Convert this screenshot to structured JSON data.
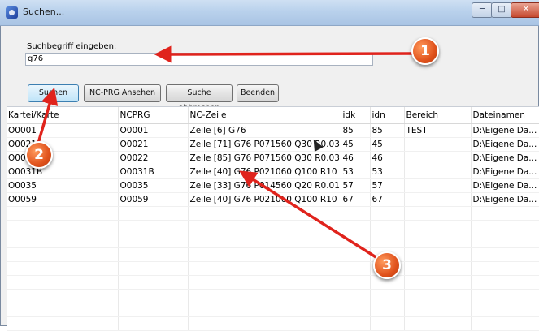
{
  "window": {
    "title": "Suchen...",
    "min_icon": "minimize-icon",
    "max_icon": "maximize-icon",
    "close_icon": "close-icon"
  },
  "search": {
    "label": "Suchbegriff eingeben:",
    "value": "g76"
  },
  "buttons": {
    "search": "Suchen",
    "view": "NC-PRG Ansehen",
    "cancel": "Suche abbrechen",
    "exit": "Beenden"
  },
  "table": {
    "columns": [
      "Kartei/Karte",
      "NCPRG",
      "NC-Zeile",
      "idk",
      "idn",
      "Bereich",
      "Dateinamen"
    ],
    "rows": [
      [
        "O0001",
        "O0001",
        "Zeile [6] G76",
        "85",
        "85",
        "TEST",
        "D:\\Eigene Da..."
      ],
      [
        "O0021",
        "O0021",
        "Zeile [71] G76 P071560 Q30 R0.03",
        "45",
        "45",
        "",
        "D:\\Eigene Da..."
      ],
      [
        "O0022",
        "O0022",
        "Zeile [85] G76 P071560 Q30 R0.03",
        "46",
        "46",
        "",
        "D:\\Eigene Da..."
      ],
      [
        "O0031B",
        "O0031B",
        "Zeile [40] G76 P021060 Q100 R10",
        "53",
        "53",
        "",
        "D:\\Eigene Da..."
      ],
      [
        "O0035",
        "O0035",
        "Zeile [33] G76 P014560 Q20 R0.01",
        "57",
        "57",
        "",
        "D:\\Eigene Da..."
      ],
      [
        "O0059",
        "O0059",
        "Zeile [40] G76 P021060 Q100 R10",
        "67",
        "67",
        "",
        "D:\\Eigene Da..."
      ]
    ]
  },
  "annotations": {
    "badge1": "1",
    "badge2": "2",
    "badge3": "3",
    "arrow_color": "#e0231c"
  }
}
